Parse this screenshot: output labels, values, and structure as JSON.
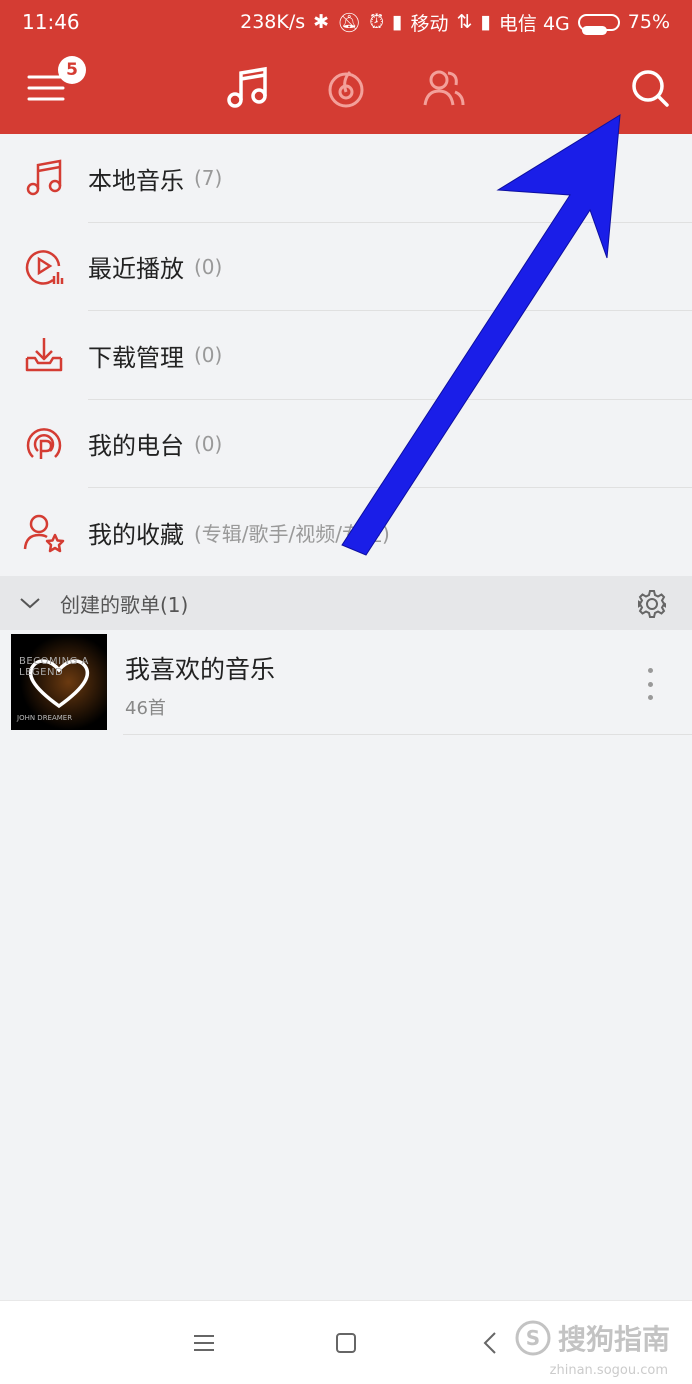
{
  "status_bar": {
    "time": "11:46",
    "net_speed": "238K/s",
    "carrier1": "移动",
    "carrier2": "电信 4G",
    "battery": "75%",
    "battery_level": 0.75
  },
  "top_nav": {
    "badge_count": "5",
    "icons": [
      "menu-icon",
      "music-note-icon",
      "netease-logo-icon",
      "friends-icon",
      "search-icon"
    ]
  },
  "menu": [
    {
      "label": "本地音乐",
      "count": "(7)",
      "icon": "music-note-icon"
    },
    {
      "label": "最近播放",
      "count": "(0)",
      "icon": "recent-play-icon"
    },
    {
      "label": "下载管理",
      "count": "(0)",
      "icon": "download-icon"
    },
    {
      "label": "我的电台",
      "count": "(0)",
      "icon": "radio-icon"
    },
    {
      "label": "我的收藏",
      "count": "(专辑/歌手/视频/专栏)",
      "icon": "favorite-user-icon"
    }
  ],
  "section": {
    "title": "创建的歌单(1)"
  },
  "playlist": {
    "title": "我喜欢的音乐",
    "subtitle": "46首",
    "cover_text1": "BECOMING A LEGEND",
    "cover_text2": "JOHN DREAMER"
  },
  "watermark": {
    "text": "搜狗指南",
    "sub": "zhinan.sogou.com"
  },
  "colors": {
    "brand": "#d43c33",
    "arrow": "#1a1ee8"
  }
}
